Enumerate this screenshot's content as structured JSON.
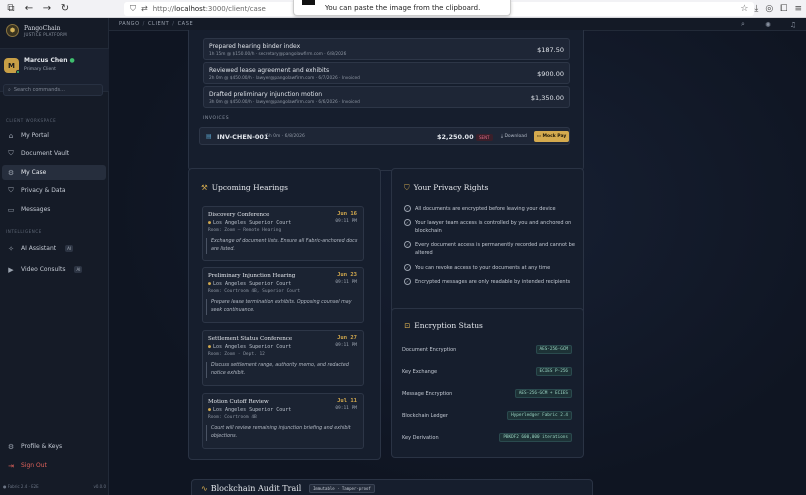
{
  "browser": {
    "url_prefix": "http://",
    "url_host": "localhost",
    "url_path": ":3000/client/case",
    "toast": "You can paste the image from the clipboard."
  },
  "sidebar": {
    "brand_name": "PangoChain",
    "brand_sub": "JUSTICE PLATFORM",
    "user_initial": "M",
    "user_name": "Marcus Chen",
    "user_role": "Primary Client",
    "search_placeholder": "Search commands...",
    "section_workspace": "CLIENT WORKSPACE",
    "workspace_items": [
      {
        "label": "My Portal"
      },
      {
        "label": "Document Vault"
      },
      {
        "label": "My Case"
      },
      {
        "label": "Privacy & Data"
      },
      {
        "label": "Messages"
      }
    ],
    "section_intelligence": "INTELLIGENCE",
    "intel_items": [
      {
        "label": "AI Assistant",
        "badge": "AI"
      },
      {
        "label": "Video Consults",
        "badge": "AI"
      }
    ],
    "profile_label": "Profile & Keys",
    "signout_label": "Sign Out",
    "footer_left": "● Fabric 2.4 · E2E",
    "footer_right": "v0.0.0"
  },
  "breadcrumb": [
    "PANGO",
    "CLIENT",
    "CASE"
  ],
  "time_entries": [
    {
      "desc": "Prepared hearing binder index",
      "meta": "1h 15m @ $150.00/h · secretary@pangolawfirm.com · 6/8/2026",
      "amount": "$187.50"
    },
    {
      "desc": "Reviewed lease agreement and exhibits",
      "meta": "2h 0m @ $450.00/h · lawyer@pangolawfirm.com · 6/7/2026 · Invoiced",
      "amount": "$900.00"
    },
    {
      "desc": "Drafted preliminary injunction motion",
      "meta": "3h 0m @ $450.00/h · lawyer@pangolawfirm.com · 6/6/2026 · Invoiced",
      "amount": "$1,350.00"
    }
  ],
  "invoices": {
    "label": "INVOICES",
    "id": "INV-CHEN-001",
    "meta": "5h 0m · 6/8/2026",
    "amount": "$2,250.00",
    "status": "SENT",
    "download": "Download",
    "mock_pay": "Mock Pay"
  },
  "hearings": {
    "title": "Upcoming Hearings",
    "items": [
      {
        "title": "Discovery Conference",
        "date": "Jun 16",
        "time": "09:11 PM",
        "court": "Los Angeles Superior Court",
        "room": "Room: Zoom — Remote Hearing",
        "note": "Exchange of document lists. Ensure all Fabric-anchored docs are listed."
      },
      {
        "title": "Preliminary Injunction Hearing",
        "date": "Jun 23",
        "time": "09:11 PM",
        "court": "Los Angeles Superior Court",
        "room": "Room: Courtroom 4B, Superior Court",
        "note": "Prepare lease termination exhibits. Opposing counsel may seek continuance."
      },
      {
        "title": "Settlement Status Conference",
        "date": "Jun 27",
        "time": "09:11 PM",
        "court": "Los Angeles Superior Court",
        "room": "Room: Zoom · Dept. 12",
        "note": "Discuss settlement range, authority memo, and redacted notice exhibit."
      },
      {
        "title": "Motion Cutoff Review",
        "date": "Jul 11",
        "time": "09:11 PM",
        "court": "Los Angeles Superior Court",
        "room": "Room: Courtroom 4B",
        "note": "Court will review remaining injunction briefing and exhibit objections."
      }
    ]
  },
  "privacy": {
    "title": "Your Privacy Rights",
    "items": [
      "All documents are encrypted before leaving your device",
      "Your lawyer team access is controlled by you and anchored on blockchain",
      "Every document access is permanently recorded and cannot be altered",
      "You can revoke access to your documents at any time",
      "Encrypted messages are only readable by intended recipients"
    ]
  },
  "encryption": {
    "title": "Encryption Status",
    "items": [
      {
        "key": "Document Encryption",
        "value": "AES-256-GCM"
      },
      {
        "key": "Key Exchange",
        "value": "ECIES P-256"
      },
      {
        "key": "Message Encryption",
        "value": "AES-256-GCM + ECIES"
      },
      {
        "key": "Blockchain Ledger",
        "value": "Hyperledger Fabric 2.4"
      },
      {
        "key": "Key Derivation",
        "value": "PBKDF2 600,000 iterations"
      }
    ]
  },
  "audit": {
    "title": "Blockchain Audit Trail",
    "badge": "Immutable · Tamper-proof"
  },
  "colors": {
    "accent": "#d4aa4e",
    "sent": "#e06a86",
    "online": "#3fbf6e",
    "signout": "#e0625a"
  }
}
